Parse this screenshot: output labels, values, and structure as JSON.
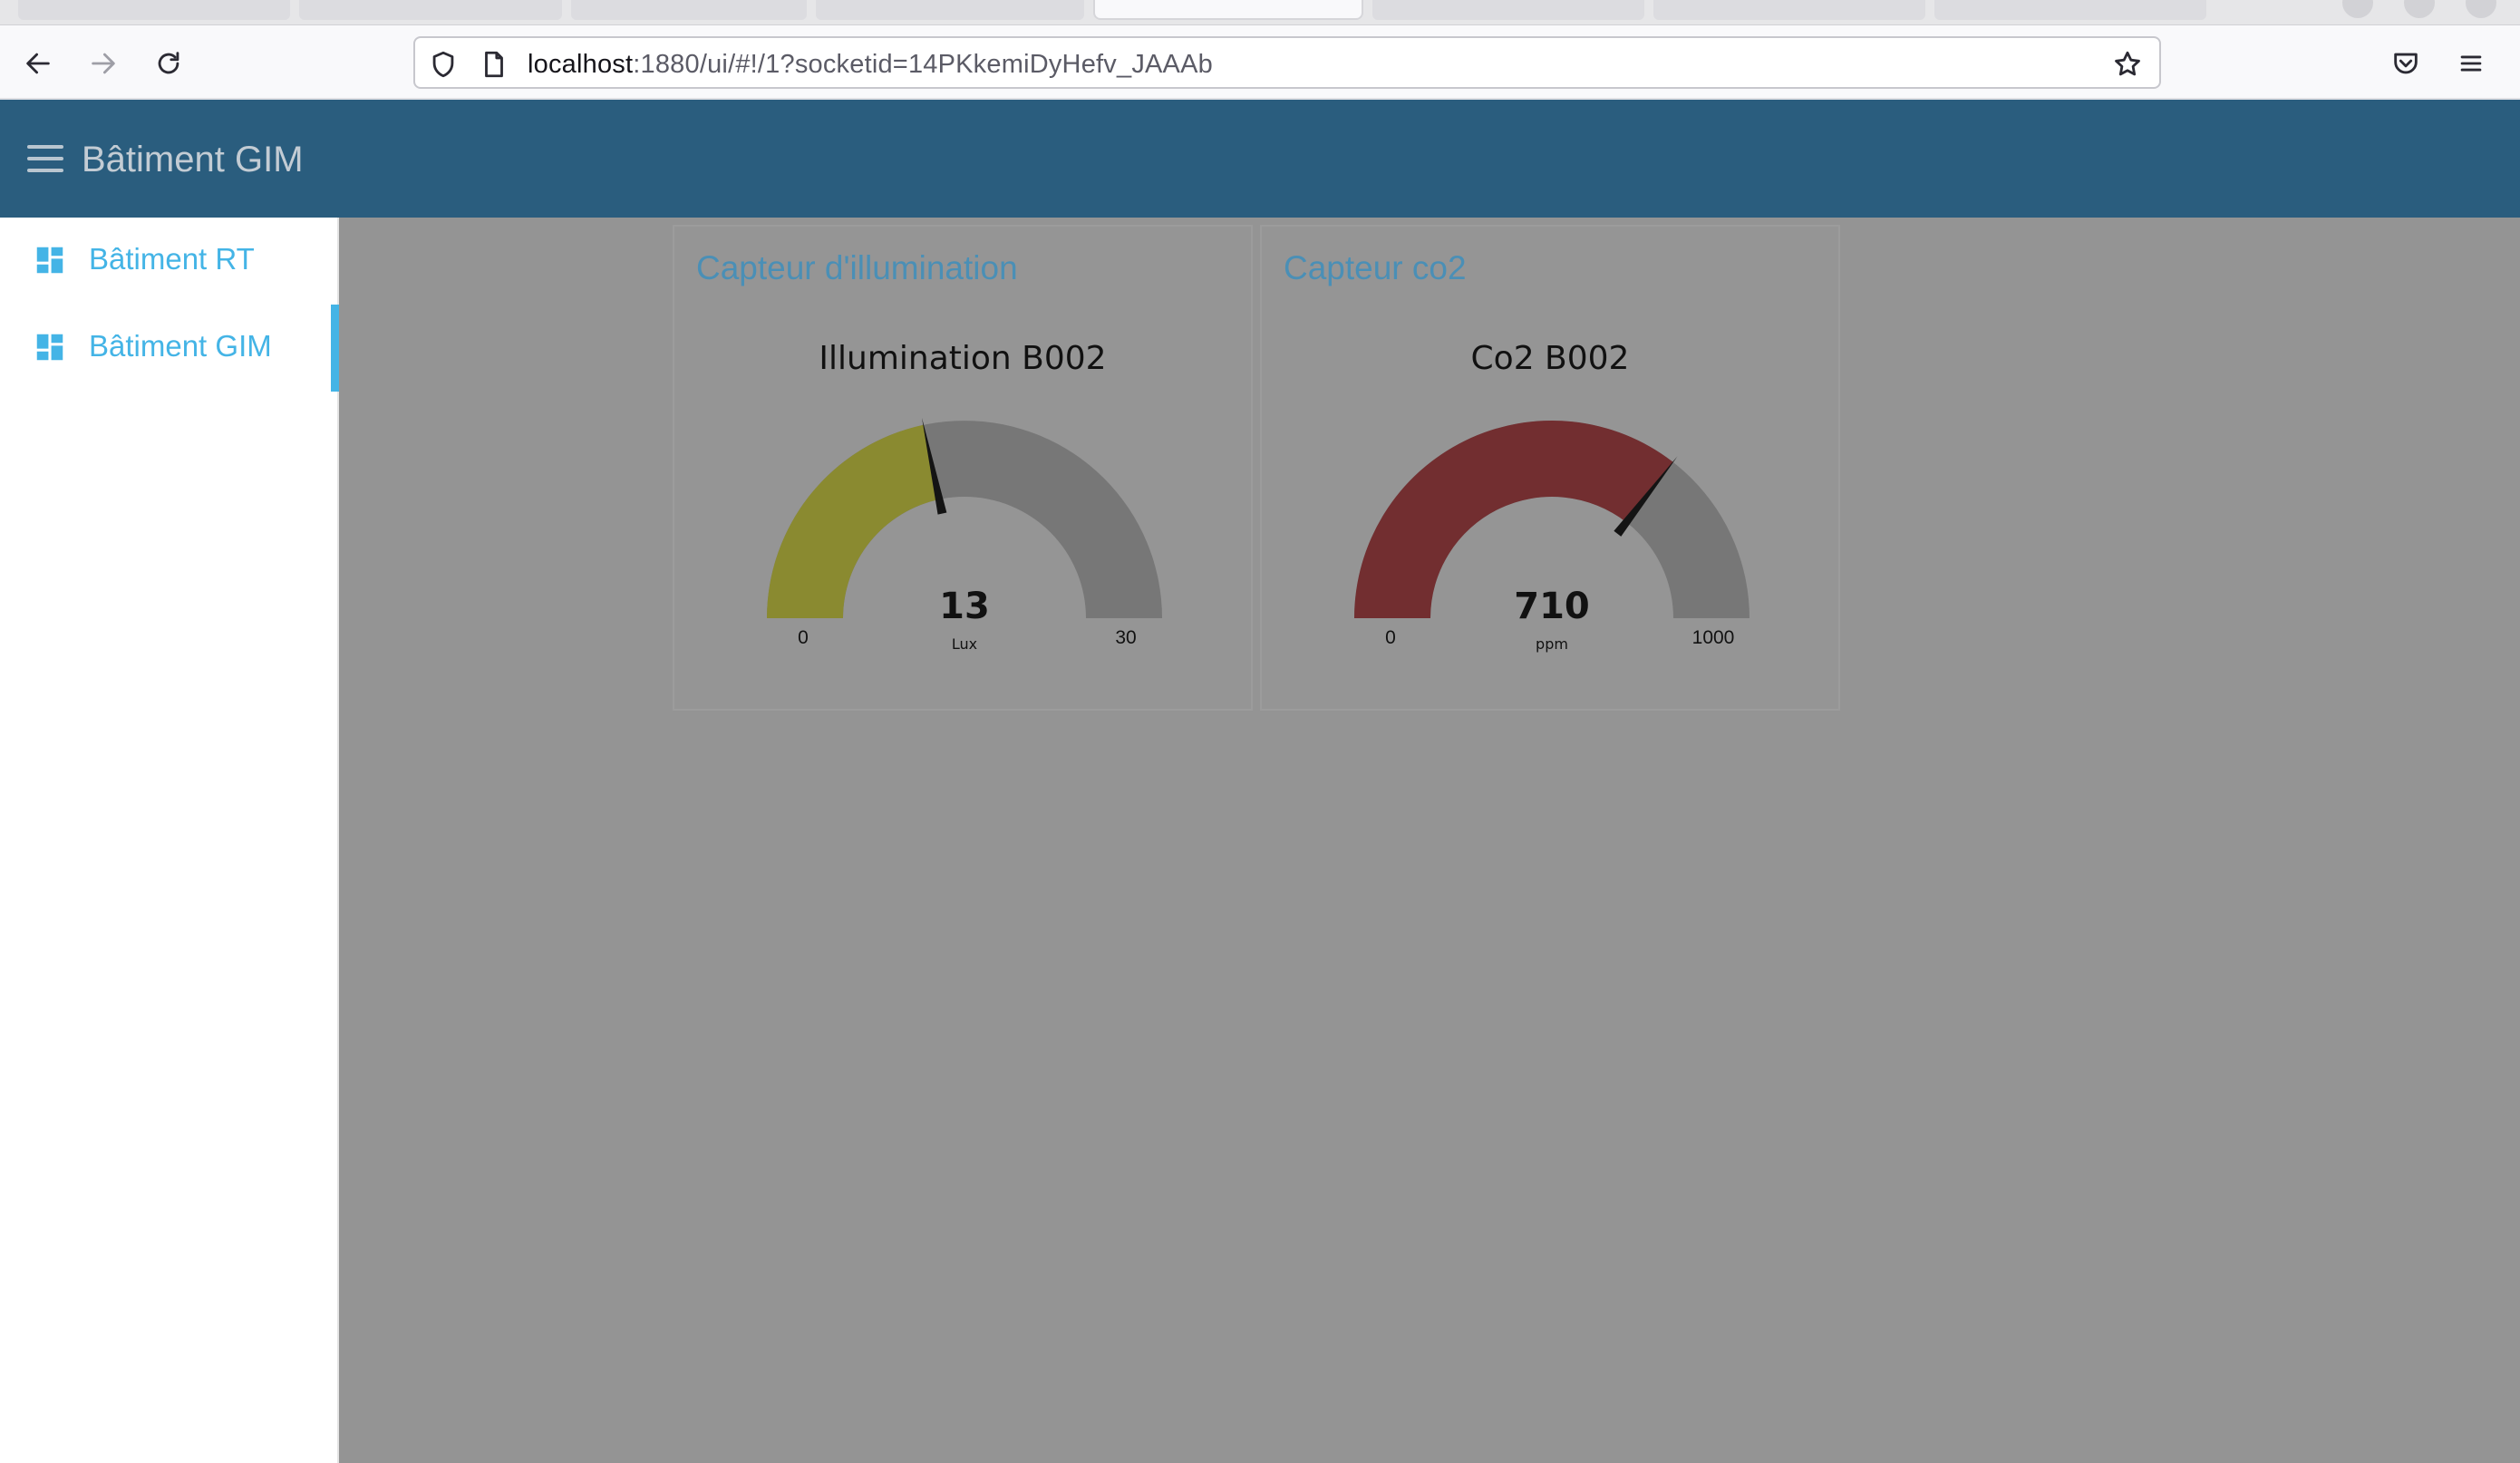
{
  "browser": {
    "url_host": "localhost",
    "url_rest": ":1880/ui/#!/1?socketid=14PKkemiDyHefv_JAAAb"
  },
  "dashboard": {
    "header_title": "Bâtiment GIM",
    "sidebar_items": [
      {
        "label": "Bâtiment RT",
        "active": false
      },
      {
        "label": "Bâtiment GIM",
        "active": true
      }
    ]
  },
  "widgets": [
    {
      "group_title": "Capteur d'illumination",
      "gauge_label": "Illumination B002",
      "value": 13,
      "value_text": "13",
      "unit": "Lux",
      "min": 0,
      "max": 30,
      "min_text": "0",
      "max_text": "30",
      "fill_color": "#8a8a30",
      "track_color": "#777777"
    },
    {
      "group_title": "Capteur co2",
      "gauge_label": "Co2 B002",
      "value": 710,
      "value_text": "710",
      "unit": "ppm",
      "min": 0,
      "max": 1000,
      "min_text": "0",
      "max_text": "1000",
      "fill_color": "#722e30",
      "track_color": "#777777"
    }
  ]
}
